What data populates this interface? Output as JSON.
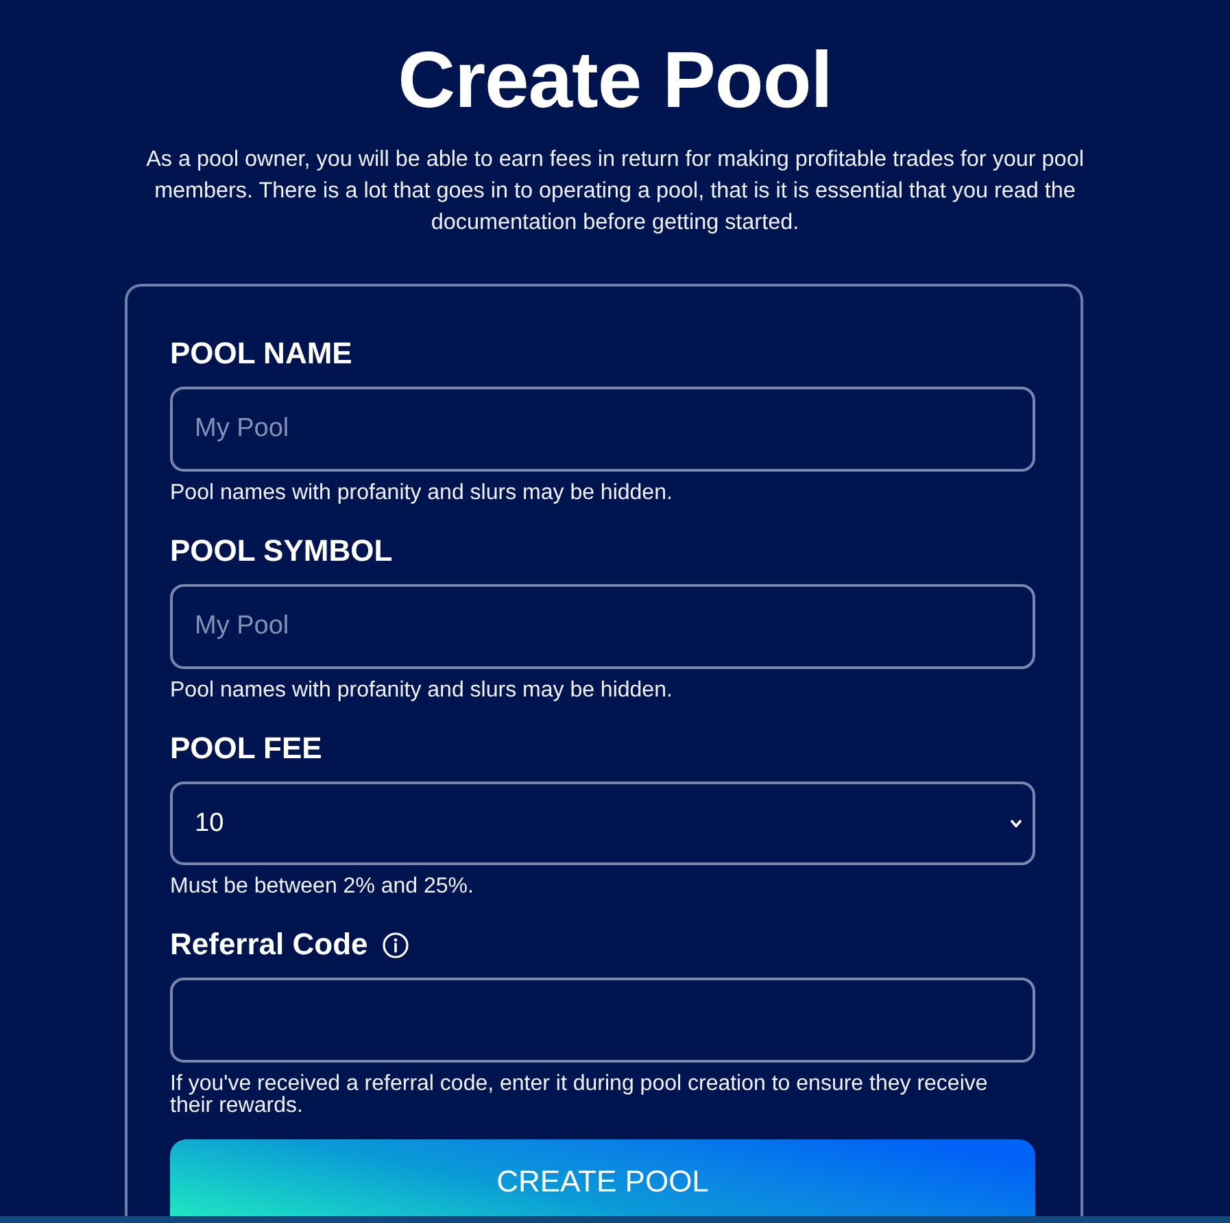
{
  "header": {
    "title": "Create Pool",
    "intro": "As a pool owner, you will be able to earn fees in return for making profitable trades for your pool members. There is a lot that goes in to operating a pool, that is it is essential that you read the documentation before getting started."
  },
  "form": {
    "fields": [
      {
        "kind": "text",
        "label": "POOL NAME",
        "placeholder": "My Pool",
        "help": "Pool names with profanity and slurs may be hidden."
      },
      {
        "kind": "text",
        "label": "POOL SYMBOL",
        "placeholder": "My Pool",
        "help": "Pool names with profanity and slurs may be hidden."
      },
      {
        "kind": "select",
        "label": "POOL FEE",
        "value": "10",
        "help": "Must be between 2% and 25%."
      },
      {
        "kind": "text",
        "label": "Referral Code",
        "info": true,
        "help": "If you've received a referral code, enter it during pool creation to ensure they receive their rewards."
      }
    ],
    "submit": "CREATE POOL"
  }
}
